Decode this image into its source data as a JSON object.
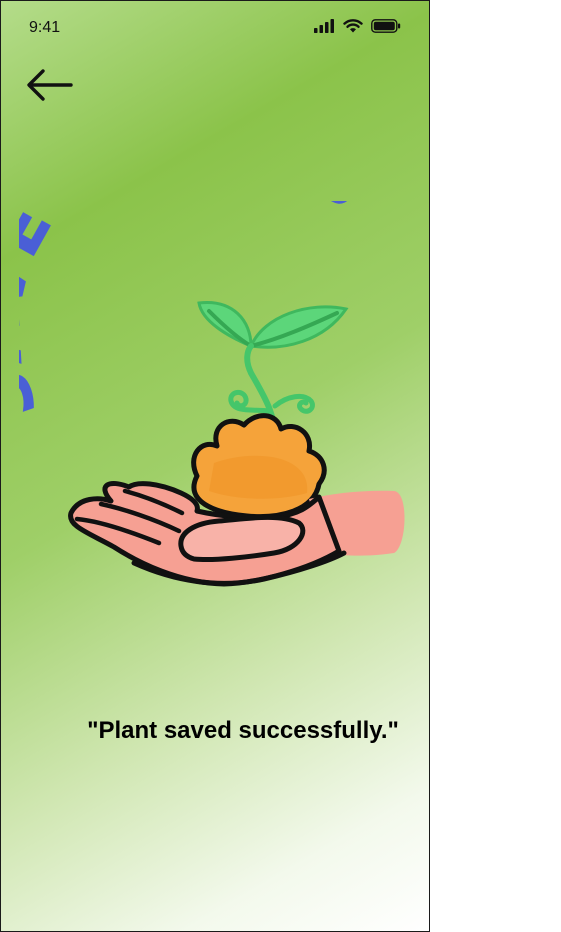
{
  "status_bar": {
    "time": "9:41",
    "signal_icon": "cellular-signal-icon",
    "wifi_icon": "wifi-icon",
    "battery_icon": "battery-icon"
  },
  "navigation": {
    "back_icon": "arrow-left-icon"
  },
  "illustration": {
    "logo_text": "SAVE PLANTS",
    "image": "hand-holding-sprout-illustration"
  },
  "message": {
    "text": "\"Plant saved successfully.\""
  },
  "colors": {
    "background_green": "#8bc34a",
    "logo_blue": "#4a5fd6",
    "leaf_green": "#5cd67a",
    "soil_orange": "#f5a33a",
    "hand_pink": "#f6a093"
  }
}
